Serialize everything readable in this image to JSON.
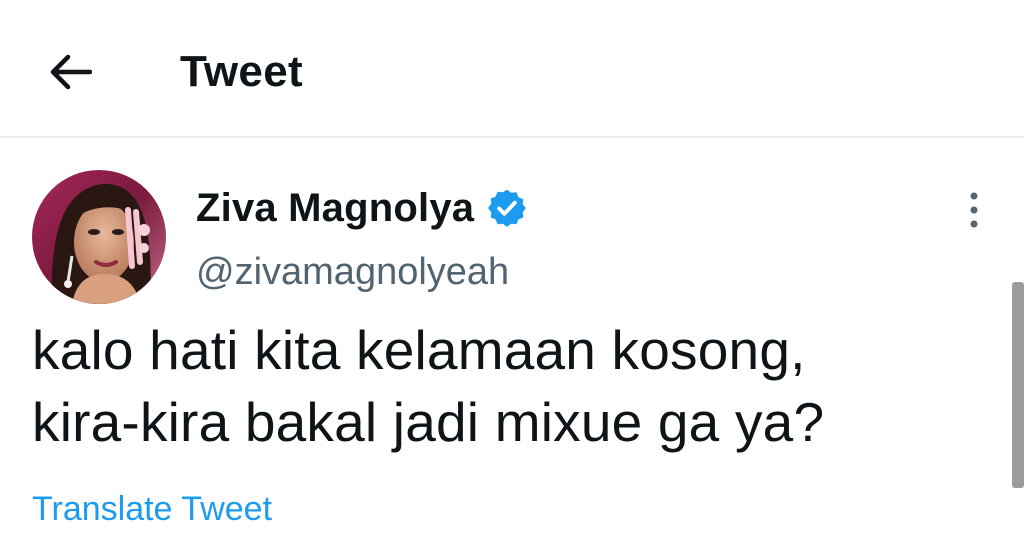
{
  "header": {
    "back_icon": "arrow-left-icon",
    "title": "Tweet"
  },
  "tweet": {
    "author": {
      "display_name": "Ziva Magnolya",
      "handle": "@zivamagnolyeah",
      "verified": true,
      "verified_icon": "verified-badge-icon"
    },
    "more_icon": "more-vertical-icon",
    "text_lines": [
      "kalo hati kita kelamaan kosong,",
      "kira-kira bakal jadi mixue ga ya?"
    ],
    "translate_label": "Translate Tweet"
  },
  "colors": {
    "accent": "#1d9bf0",
    "text_primary": "#0f1419",
    "text_secondary": "#536471",
    "divider": "#e6ecf0",
    "scrollbar": "#9b9b9b"
  }
}
